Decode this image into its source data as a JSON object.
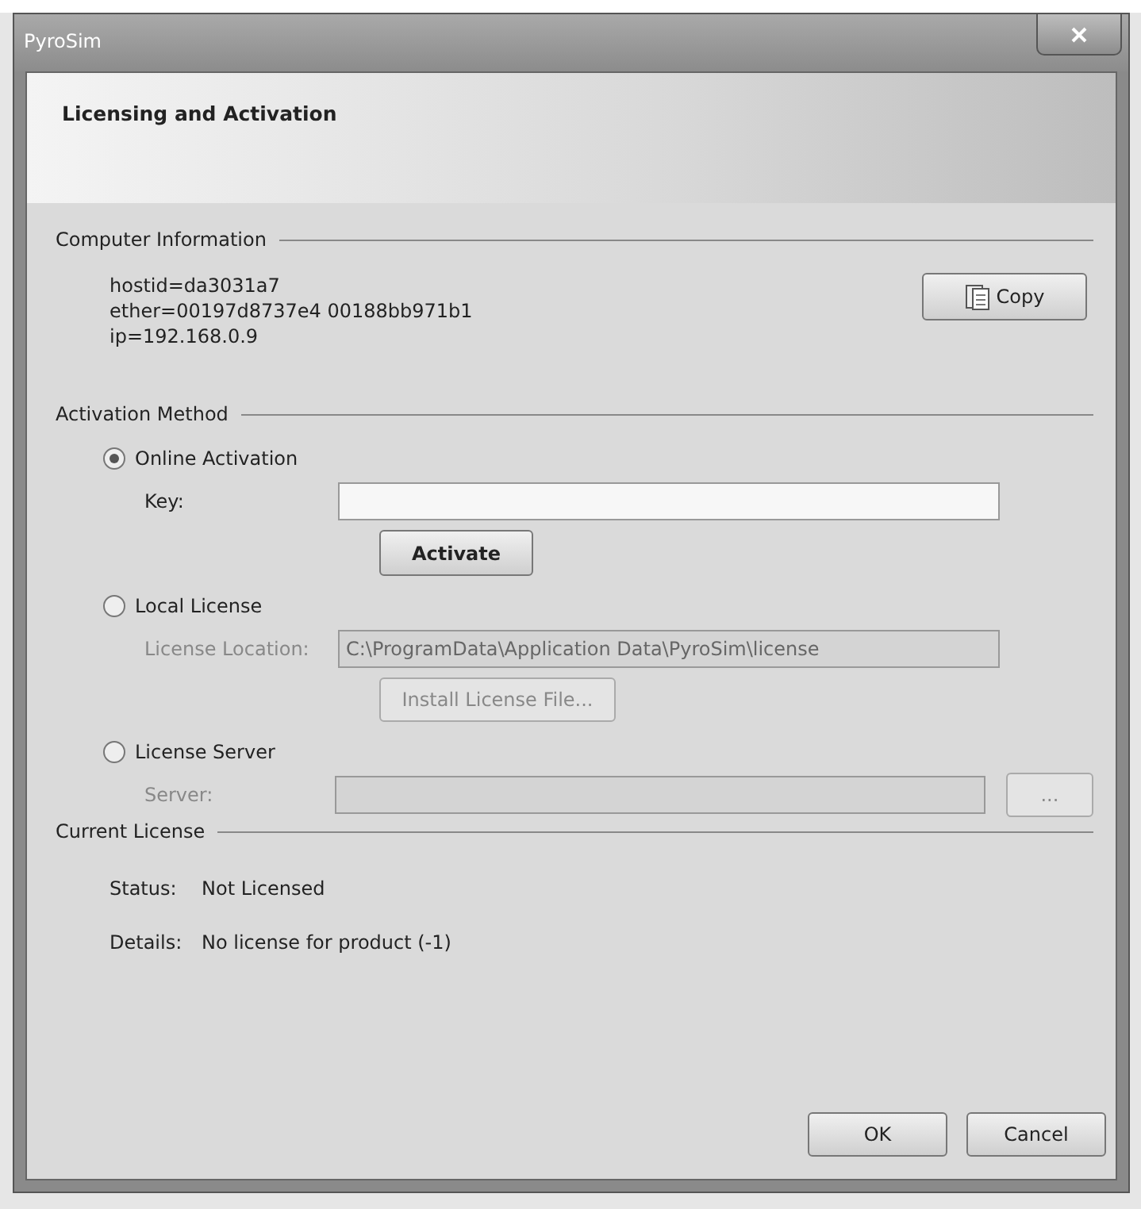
{
  "window": {
    "title": "PyroSim"
  },
  "header": {
    "title": "Licensing and Activation"
  },
  "computer_info": {
    "heading": "Computer Information",
    "lines": [
      "hostid=da3031a7",
      "ether=00197d8737e4 00188bb971b1",
      "ip=192.168.0.9"
    ],
    "copy_button": "Copy"
  },
  "activation": {
    "heading": "Activation Method",
    "options": [
      {
        "label": "Online Activation",
        "selected": true,
        "disabled": false,
        "field_label": "Key:",
        "kind": "stacked",
        "button": "Activate"
      },
      {
        "label": "Local License",
        "selected": false,
        "disabled": true,
        "field_label": "License Location:",
        "field_value": "C:\\ProgramData\\Application Data\\PyroSim\\license",
        "kind": "stacked",
        "button": "Install License File..."
      },
      {
        "label": "License Server",
        "selected": false,
        "disabled": true,
        "field_label": "Server:",
        "kind": "inline",
        "button": "..."
      }
    ]
  },
  "current_license": {
    "heading": "Current License",
    "rows": [
      {
        "label": "Status:",
        "value": "Not Licensed"
      },
      {
        "label": "Details:",
        "value": "No license for product (-1)"
      }
    ]
  },
  "buttons": [
    {
      "label": "OK"
    },
    {
      "label": "Cancel"
    }
  ]
}
